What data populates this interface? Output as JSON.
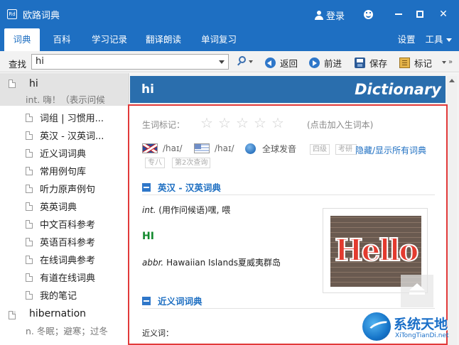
{
  "window": {
    "app_icon_text": "Rd",
    "title": "欧路词典",
    "login_label": "登录",
    "minimize_glyph": "—",
    "close_glyph": "✕"
  },
  "menu": {
    "tabs": [
      {
        "label": "词典",
        "active": true
      },
      {
        "label": "百科"
      },
      {
        "label": "学习记录"
      },
      {
        "label": "翻译朗读"
      },
      {
        "label": "单词复习"
      }
    ],
    "settings_label": "设置",
    "tools_label": "工具"
  },
  "toolbar": {
    "find_label": "查找",
    "search_value": "hi",
    "back_label": "返回",
    "forward_label": "前进",
    "save_label": "保存",
    "mark_label": "标记",
    "overflow_glyph": "»"
  },
  "sidebar": {
    "entries": [
      {
        "word": "hi",
        "gloss": "int. 嗨！（表示问候",
        "children": [
          "词组 | 习惯用...",
          "英汉 - 汉英词...",
          "近义词词典",
          "常用例句库",
          "听力原声例句",
          "英英词典",
          "中文百科参考",
          "英语百科参考",
          "在线词典参考",
          "有道在线词典",
          "我的笔记"
        ]
      },
      {
        "word": "hibernation",
        "gloss": "n. 冬眠；避寒；过冬"
      }
    ]
  },
  "entry": {
    "headword": "hi",
    "brand": "Dictionary",
    "vocab_label": "生词标记：",
    "star_glyph": "☆",
    "rating_max": 5,
    "rating_value": 0,
    "add_hint": "(点击加入生词本)",
    "uk_phonetic": "/haɪ/",
    "us_phonetic": "/haɪ/",
    "global_pron_label": "全球发音",
    "tags": [
      "四级",
      "考研",
      "专八",
      "第2次查询"
    ],
    "toggle_all_label": "隐藏/显示所有词典",
    "sections": {
      "ec_title": "英汉 - 汉英词典",
      "ec_def_pos": "int.",
      "ec_def_text": "(用作问候语)嘿, 喂",
      "abbr_heading": "HI",
      "abbr_pos": "abbr.",
      "abbr_text": "Hawaiian Islands夏威夷群岛",
      "syn_title": "近义词词典",
      "syn_label": "近义词："
    },
    "image_text": "Hello"
  },
  "watermark": {
    "cn": "系统天地",
    "en": "XiTongTianDi.net"
  }
}
